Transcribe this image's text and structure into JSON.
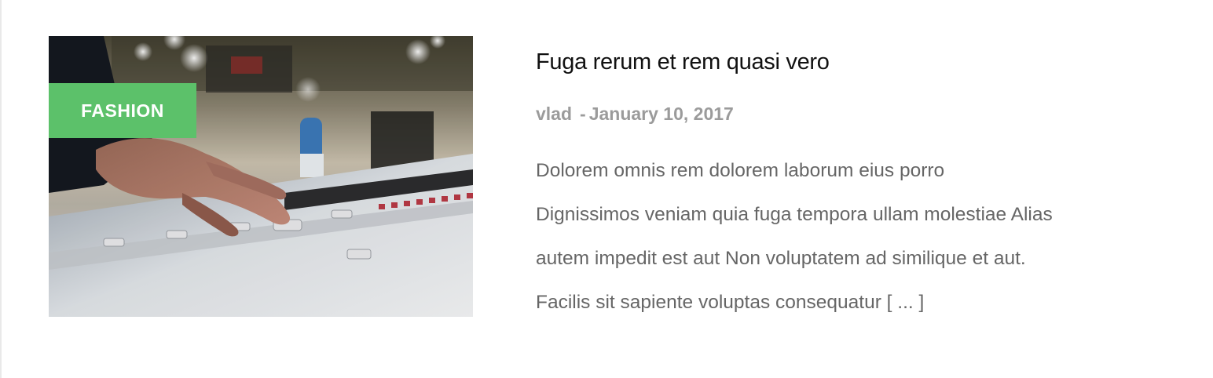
{
  "post": {
    "category": "FASHION",
    "title": "Fuga rerum et rem quasi vero",
    "author": "vlad",
    "date_separator": "-",
    "date": "January 10, 2017",
    "excerpt_lines": [
      "Dolorem omnis rem dolorem laborum eius porro",
      "Dignissimos veniam quia fuga tempora ullam molestiae Alias",
      "autem impedit est aut Non voluptatem ad similique et aut.",
      "Facilis sit sapiente voluptas consequatur [ ... ]"
    ]
  },
  "colors": {
    "badge": "#5cc16a",
    "title": "#111111",
    "meta": "#9b9b9b",
    "excerpt": "#666666"
  },
  "thumbnail": {
    "icon": "audio-mixing-console-photo"
  }
}
